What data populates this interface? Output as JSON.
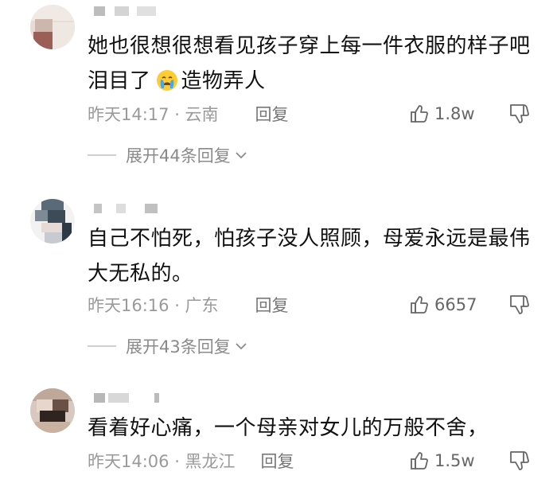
{
  "comments": [
    {
      "text_line1": "她也很想很想看见孩子穿上每一件衣服的样子吧",
      "text_line2": "泪目了",
      "text_line2_tail": "造物弄人",
      "emoji": "crying-emoji",
      "time_location": "昨天14:17 · 云南",
      "reply_label": "回复",
      "likes": "1.8w",
      "expand_label": "展开44条回复"
    },
    {
      "text_line1": "自己不怕死，怕孩子没人照顾，母爱永远是最伟",
      "text_line2": "大无私的。",
      "time_location": "昨天16:16 · 广东",
      "reply_label": "回复",
      "likes": "6657",
      "expand_label": "展开43条回复"
    },
    {
      "text_line1": "看着好心痛，一个母亲对女儿的万般不舍，",
      "time_location": "昨天14:06 · 黑龙江",
      "reply_label": "回复",
      "likes": "1.5w"
    }
  ],
  "icons": {
    "like": "thumbs-up-outline-icon",
    "dislike": "thumbs-down-outline-icon",
    "expand": "chevron-down-icon"
  },
  "colors": {
    "text": "#111111",
    "meta": "#9a9a9a",
    "background": "#ffffff"
  }
}
